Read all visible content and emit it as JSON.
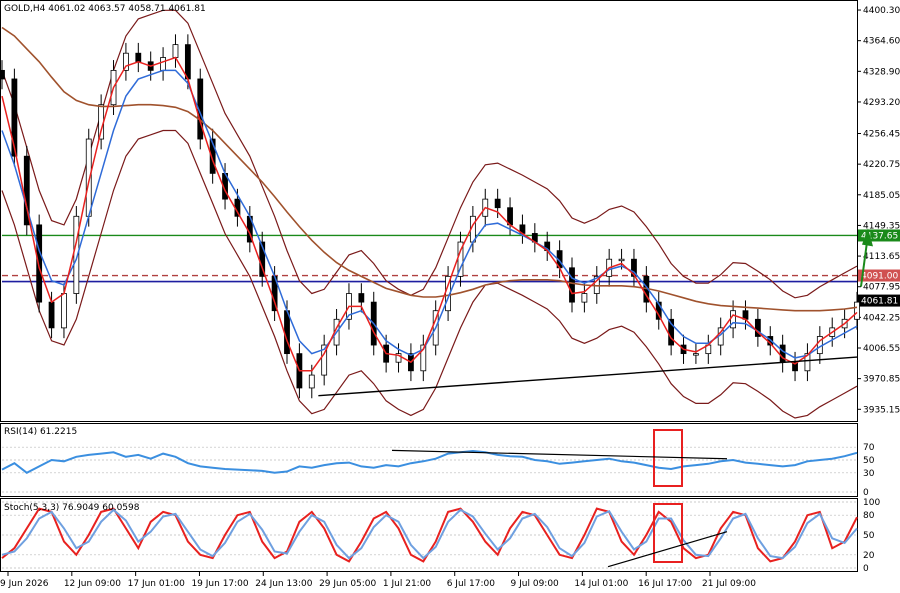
{
  "header": {
    "symbol_line": "GOLD,H4  4061.02  4063.57  4058.71  4061.81"
  },
  "colors": {
    "candle": "#000000",
    "ma_fast": "#e8211f",
    "ma_mid": "#2f6bd8",
    "ma_slow": "#a0522d",
    "bollinger": "#7a1a1a",
    "support_line": "#000000",
    "level_green": "#1a8a1a",
    "level_blue": "#1e1ea0",
    "level_dashed": "#b04040",
    "arrow": "#1a8a1a",
    "rsi_line": "#3b8fe0",
    "stoch_main": "#e8211f",
    "stoch_signal": "#6fa0e0",
    "highlight_box": "#e82020"
  },
  "chart_data": [
    {
      "type": "line",
      "panel": "price",
      "title": "GOLD,H4",
      "ohlc": {
        "open": 4061.02,
        "high": 4063.57,
        "low": 4058.71,
        "close": 4061.81
      },
      "ylim": [
        3925,
        4405
      ],
      "y_ticks": [
        "4400.30",
        "4364.60",
        "4328.90",
        "4293.20",
        "4256.45",
        "4220.75",
        "4185.05",
        "4149.35",
        "4113.65",
        "4077.95",
        "4042.25",
        "4006.55",
        "3970.85",
        "3935.15"
      ],
      "x_ticks": [
        "9 Jun 2026",
        "12 Jun 09:00",
        "17 Jun 01:00",
        "19 Jun 17:00",
        "24 Jun 13:00",
        "29 Jun 05:00",
        "1 Jul 21:00",
        "6 Jul 17:00",
        "9 Jul 09:00",
        "14 Jul 01:00",
        "16 Jul 17:00",
        "21 Jul 09:00"
      ],
      "price_labels": [
        {
          "text": "4137.65",
          "value": 4137.65,
          "bg": "#1a8a1a",
          "fg": "#ffffff"
        },
        {
          "text": "4091.00",
          "value": 4091.0,
          "bg": "#d05050",
          "fg": "#ffffff"
        },
        {
          "text": "4061.81",
          "value": 4061.81,
          "bg": "#000000",
          "fg": "#ffffff"
        }
      ],
      "horizontal_levels": [
        {
          "value": 4137.65,
          "style": "solid",
          "color": "green"
        },
        {
          "value": 4091.0,
          "style": "dashed",
          "color": "red"
        },
        {
          "value": 4084.0,
          "style": "solid",
          "color": "blue"
        }
      ],
      "support_trendline": {
        "from": {
          "bar": 0.37,
          "value": 3951
        },
        "to": {
          "bar": 1.0,
          "value": 3996
        }
      },
      "close_series": [
        4320,
        4230,
        4150,
        4060,
        4030,
        4070,
        4160,
        4250,
        4290,
        4330,
        4350,
        4340,
        4330,
        4345,
        4360,
        4320,
        4250,
        4210,
        4180,
        4160,
        4130,
        4090,
        4050,
        4000,
        3960,
        3975,
        4010,
        4040,
        4070,
        4060,
        4010,
        3990,
        4000,
        3980,
        4010,
        4050,
        4090,
        4130,
        4160,
        4180,
        4170,
        4150,
        4140,
        4130,
        4120,
        4100,
        4060,
        4070,
        4090,
        4110,
        4110,
        4090,
        4060,
        4040,
        4010,
        4000,
        4000,
        4010,
        4030,
        4050,
        4040,
        4020,
        4010,
        3990,
        3980,
        4000,
        4020,
        4030,
        4040,
        4060
      ],
      "ma_fast_series": [
        4300,
        4240,
        4170,
        4100,
        4060,
        4070,
        4130,
        4200,
        4260,
        4310,
        4335,
        4340,
        4335,
        4340,
        4345,
        4320,
        4270,
        4225,
        4190,
        4165,
        4140,
        4100,
        4060,
        4015,
        3980,
        3980,
        4000,
        4030,
        4055,
        4055,
        4025,
        4000,
        3998,
        3990,
        4005,
        4040,
        4080,
        4120,
        4150,
        4170,
        4165,
        4150,
        4140,
        4130,
        4120,
        4100,
        4070,
        4072,
        4085,
        4100,
        4105,
        4092,
        4068,
        4045,
        4018,
        4005,
        4002,
        4010,
        4025,
        4045,
        4040,
        4025,
        4012,
        3995,
        3988,
        3998,
        4015,
        4025,
        4035,
        4048
      ],
      "ma_mid_series": [
        4260,
        4220,
        4170,
        4120,
        4085,
        4080,
        4110,
        4160,
        4210,
        4260,
        4300,
        4320,
        4325,
        4330,
        4330,
        4315,
        4280,
        4245,
        4210,
        4185,
        4160,
        4125,
        4090,
        4050,
        4015,
        4000,
        4005,
        4025,
        4045,
        4050,
        4035,
        4015,
        4005,
        3998,
        4005,
        4030,
        4065,
        4100,
        4130,
        4150,
        4152,
        4145,
        4138,
        4130,
        4122,
        4108,
        4088,
        4082,
        4088,
        4098,
        4102,
        4095,
        4078,
        4058,
        4035,
        4020,
        4012,
        4012,
        4022,
        4036,
        4035,
        4026,
        4016,
        4003,
        3995,
        3998,
        4008,
        4016,
        4024,
        4032
      ],
      "ma_slow_series": [
        4380,
        4370,
        4355,
        4340,
        4322,
        4305,
        4295,
        4290,
        4288,
        4288,
        4289,
        4290,
        4290,
        4289,
        4287,
        4282,
        4272,
        4260,
        4245,
        4230,
        4215,
        4200,
        4183,
        4165,
        4148,
        4132,
        4118,
        4106,
        4097,
        4090,
        4083,
        4076,
        4072,
        4068,
        4066,
        4066,
        4068,
        4071,
        4075,
        4080,
        4083,
        4085,
        4086,
        4086,
        4086,
        4085,
        4082,
        4080,
        4079,
        4079,
        4079,
        4078,
        4076,
        4073,
        4069,
        4065,
        4061,
        4058,
        4056,
        4055,
        4054,
        4053,
        4052,
        4051,
        4050,
        4050,
        4050,
        4051,
        4052,
        4054
      ]
    },
    {
      "type": "line",
      "panel": "indicator",
      "title": "RSI(14) 61.2215",
      "ylim": [
        0,
        100
      ],
      "y_ticks": [
        "70",
        "50",
        "30",
        "0"
      ],
      "series": [
        {
          "name": "RSI(14)",
          "values": [
            35,
            45,
            30,
            40,
            50,
            48,
            55,
            58,
            60,
            62,
            55,
            58,
            52,
            60,
            55,
            45,
            40,
            38,
            36,
            35,
            34,
            33,
            30,
            32,
            40,
            38,
            42,
            45,
            46,
            40,
            38,
            42,
            40,
            45,
            48,
            52,
            60,
            62,
            64,
            62,
            58,
            56,
            55,
            50,
            48,
            44,
            46,
            48,
            50,
            52,
            48,
            46,
            42,
            38,
            36,
            40,
            42,
            44,
            48,
            50,
            46,
            44,
            42,
            40,
            42,
            48,
            50,
            52,
            56,
            61.2
          ]
        }
      ]
    },
    {
      "type": "line",
      "panel": "indicator",
      "title": "Stoch(5,3,3) 76.9049 60.0598",
      "ylim": [
        0,
        100
      ],
      "y_ticks": [
        "100",
        "80",
        "50",
        "20",
        "0"
      ],
      "series": [
        {
          "name": "Stoch %K",
          "values": [
            15,
            30,
            60,
            90,
            85,
            40,
            20,
            50,
            85,
            90,
            60,
            30,
            70,
            85,
            80,
            40,
            20,
            15,
            50,
            80,
            85,
            40,
            15,
            25,
            70,
            85,
            60,
            20,
            10,
            40,
            75,
            85,
            60,
            20,
            10,
            40,
            85,
            90,
            70,
            40,
            20,
            60,
            85,
            80,
            50,
            20,
            15,
            50,
            90,
            85,
            40,
            20,
            50,
            85,
            70,
            30,
            15,
            20,
            60,
            85,
            80,
            30,
            10,
            15,
            40,
            80,
            85,
            30,
            40,
            76.9
          ]
        },
        {
          "name": "Stoch %D",
          "values": [
            20,
            25,
            45,
            75,
            85,
            60,
            30,
            40,
            70,
            88,
            72,
            40,
            55,
            78,
            82,
            55,
            28,
            18,
            38,
            70,
            82,
            58,
            25,
            22,
            55,
            80,
            70,
            35,
            15,
            30,
            62,
            80,
            70,
            35,
            15,
            32,
            70,
            88,
            78,
            52,
            28,
            45,
            75,
            82,
            62,
            30,
            18,
            38,
            78,
            86,
            55,
            28,
            40,
            75,
            75,
            42,
            20,
            18,
            45,
            75,
            82,
            45,
            18,
            15,
            32,
            68,
            82,
            45,
            38,
            60.06
          ]
        }
      ]
    }
  ]
}
